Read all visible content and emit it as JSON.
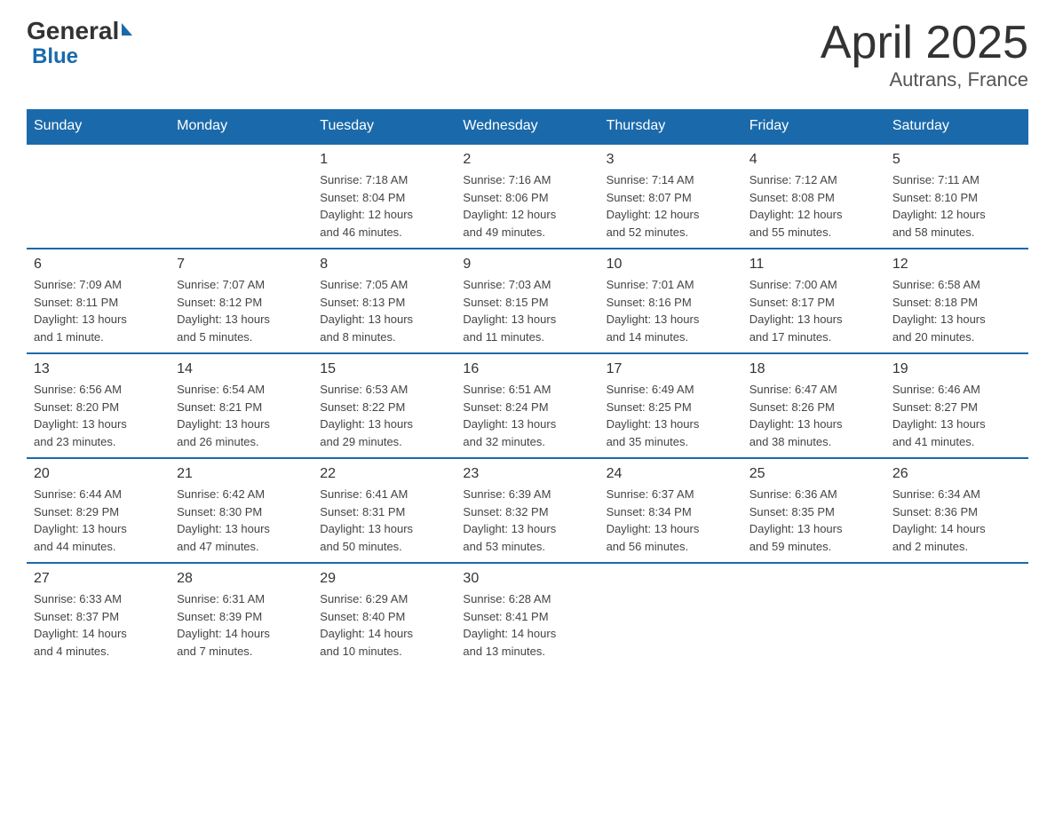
{
  "header": {
    "logo_general": "General",
    "logo_blue": "Blue",
    "title": "April 2025",
    "subtitle": "Autrans, France"
  },
  "days_of_week": [
    "Sunday",
    "Monday",
    "Tuesday",
    "Wednesday",
    "Thursday",
    "Friday",
    "Saturday"
  ],
  "weeks": [
    [
      {
        "day": "",
        "info": ""
      },
      {
        "day": "",
        "info": ""
      },
      {
        "day": "1",
        "info": "Sunrise: 7:18 AM\nSunset: 8:04 PM\nDaylight: 12 hours\nand 46 minutes."
      },
      {
        "day": "2",
        "info": "Sunrise: 7:16 AM\nSunset: 8:06 PM\nDaylight: 12 hours\nand 49 minutes."
      },
      {
        "day": "3",
        "info": "Sunrise: 7:14 AM\nSunset: 8:07 PM\nDaylight: 12 hours\nand 52 minutes."
      },
      {
        "day": "4",
        "info": "Sunrise: 7:12 AM\nSunset: 8:08 PM\nDaylight: 12 hours\nand 55 minutes."
      },
      {
        "day": "5",
        "info": "Sunrise: 7:11 AM\nSunset: 8:10 PM\nDaylight: 12 hours\nand 58 minutes."
      }
    ],
    [
      {
        "day": "6",
        "info": "Sunrise: 7:09 AM\nSunset: 8:11 PM\nDaylight: 13 hours\nand 1 minute."
      },
      {
        "day": "7",
        "info": "Sunrise: 7:07 AM\nSunset: 8:12 PM\nDaylight: 13 hours\nand 5 minutes."
      },
      {
        "day": "8",
        "info": "Sunrise: 7:05 AM\nSunset: 8:13 PM\nDaylight: 13 hours\nand 8 minutes."
      },
      {
        "day": "9",
        "info": "Sunrise: 7:03 AM\nSunset: 8:15 PM\nDaylight: 13 hours\nand 11 minutes."
      },
      {
        "day": "10",
        "info": "Sunrise: 7:01 AM\nSunset: 8:16 PM\nDaylight: 13 hours\nand 14 minutes."
      },
      {
        "day": "11",
        "info": "Sunrise: 7:00 AM\nSunset: 8:17 PM\nDaylight: 13 hours\nand 17 minutes."
      },
      {
        "day": "12",
        "info": "Sunrise: 6:58 AM\nSunset: 8:18 PM\nDaylight: 13 hours\nand 20 minutes."
      }
    ],
    [
      {
        "day": "13",
        "info": "Sunrise: 6:56 AM\nSunset: 8:20 PM\nDaylight: 13 hours\nand 23 minutes."
      },
      {
        "day": "14",
        "info": "Sunrise: 6:54 AM\nSunset: 8:21 PM\nDaylight: 13 hours\nand 26 minutes."
      },
      {
        "day": "15",
        "info": "Sunrise: 6:53 AM\nSunset: 8:22 PM\nDaylight: 13 hours\nand 29 minutes."
      },
      {
        "day": "16",
        "info": "Sunrise: 6:51 AM\nSunset: 8:24 PM\nDaylight: 13 hours\nand 32 minutes."
      },
      {
        "day": "17",
        "info": "Sunrise: 6:49 AM\nSunset: 8:25 PM\nDaylight: 13 hours\nand 35 minutes."
      },
      {
        "day": "18",
        "info": "Sunrise: 6:47 AM\nSunset: 8:26 PM\nDaylight: 13 hours\nand 38 minutes."
      },
      {
        "day": "19",
        "info": "Sunrise: 6:46 AM\nSunset: 8:27 PM\nDaylight: 13 hours\nand 41 minutes."
      }
    ],
    [
      {
        "day": "20",
        "info": "Sunrise: 6:44 AM\nSunset: 8:29 PM\nDaylight: 13 hours\nand 44 minutes."
      },
      {
        "day": "21",
        "info": "Sunrise: 6:42 AM\nSunset: 8:30 PM\nDaylight: 13 hours\nand 47 minutes."
      },
      {
        "day": "22",
        "info": "Sunrise: 6:41 AM\nSunset: 8:31 PM\nDaylight: 13 hours\nand 50 minutes."
      },
      {
        "day": "23",
        "info": "Sunrise: 6:39 AM\nSunset: 8:32 PM\nDaylight: 13 hours\nand 53 minutes."
      },
      {
        "day": "24",
        "info": "Sunrise: 6:37 AM\nSunset: 8:34 PM\nDaylight: 13 hours\nand 56 minutes."
      },
      {
        "day": "25",
        "info": "Sunrise: 6:36 AM\nSunset: 8:35 PM\nDaylight: 13 hours\nand 59 minutes."
      },
      {
        "day": "26",
        "info": "Sunrise: 6:34 AM\nSunset: 8:36 PM\nDaylight: 14 hours\nand 2 minutes."
      }
    ],
    [
      {
        "day": "27",
        "info": "Sunrise: 6:33 AM\nSunset: 8:37 PM\nDaylight: 14 hours\nand 4 minutes."
      },
      {
        "day": "28",
        "info": "Sunrise: 6:31 AM\nSunset: 8:39 PM\nDaylight: 14 hours\nand 7 minutes."
      },
      {
        "day": "29",
        "info": "Sunrise: 6:29 AM\nSunset: 8:40 PM\nDaylight: 14 hours\nand 10 minutes."
      },
      {
        "day": "30",
        "info": "Sunrise: 6:28 AM\nSunset: 8:41 PM\nDaylight: 14 hours\nand 13 minutes."
      },
      {
        "day": "",
        "info": ""
      },
      {
        "day": "",
        "info": ""
      },
      {
        "day": "",
        "info": ""
      }
    ]
  ]
}
